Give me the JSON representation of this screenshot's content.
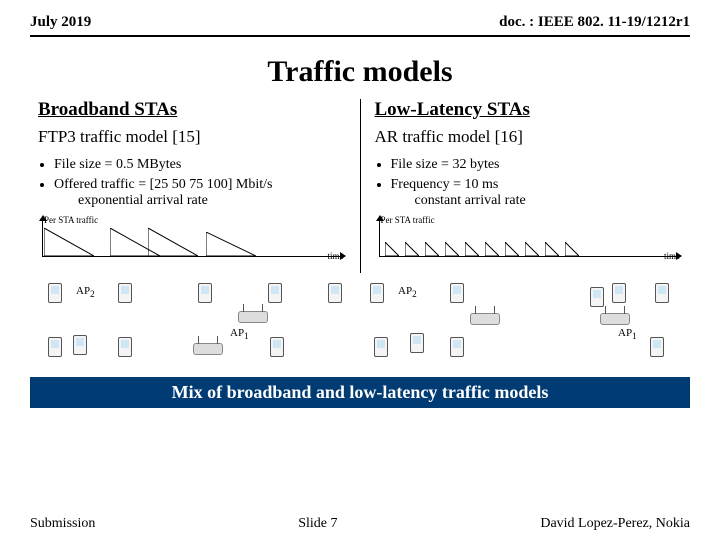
{
  "header": {
    "date": "July 2019",
    "doc": "doc. : IEEE 802. 11-19/1212r1"
  },
  "title": "Traffic models",
  "left": {
    "heading": "Broadband STAs",
    "model": "FTP3 traffic model [15]",
    "b1": "File size = 0.5 MBytes",
    "b2": "Offered traffic = [25 50 75 100] Mbit/s",
    "b2b": "exponential arrival rate",
    "plot_label": "Per STA traffic",
    "time": "time",
    "ap2": "AP",
    "ap2sub": "2",
    "ap1": "AP",
    "ap1sub": "1"
  },
  "right": {
    "heading": "Low-Latency STAs",
    "model": "AR traffic model [16]",
    "b1": "File size = 32 bytes",
    "b2": "Frequency = 10 ms",
    "b2b": "constant arrival rate",
    "plot_label": "Per STA traffic",
    "time": "time",
    "ap2": "AP",
    "ap2sub": "2",
    "ap1": "AP",
    "ap1sub": "1"
  },
  "mix": "Mix of broadband and low-latency traffic models",
  "footer": {
    "left": "Submission",
    "center": "Slide 7",
    "right": "David Lopez-Perez, Nokia"
  }
}
